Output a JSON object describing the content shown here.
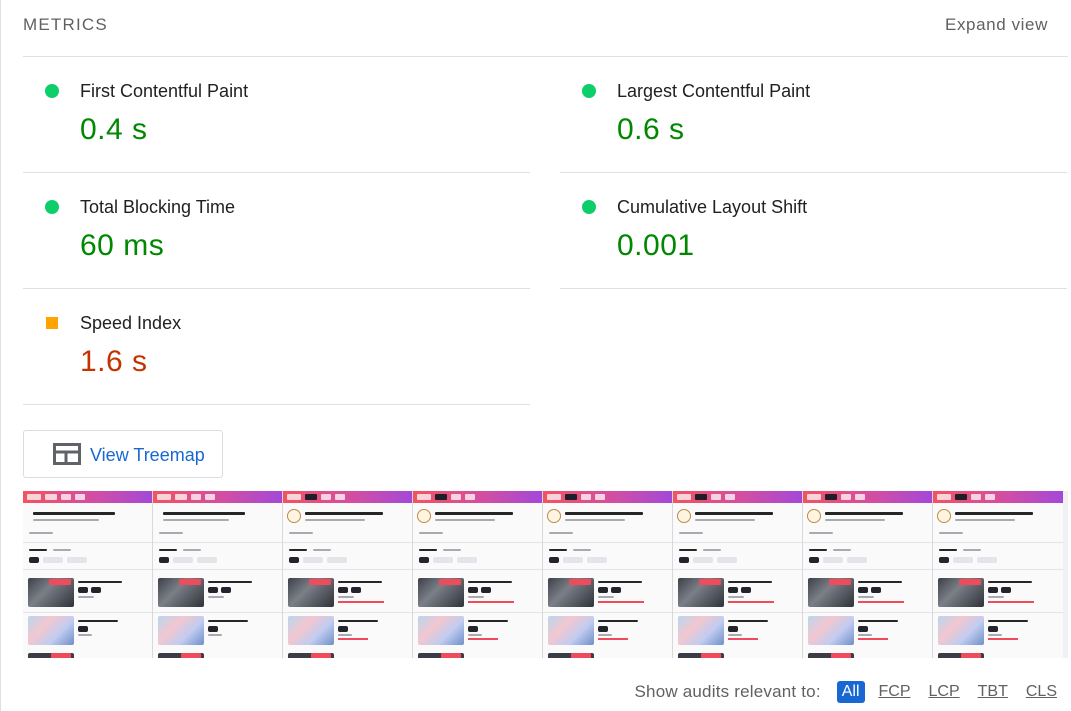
{
  "section": {
    "title": "METRICS",
    "expand_label": "Expand view"
  },
  "metrics": [
    {
      "title": "First Contentful Paint",
      "value": "0.4 s",
      "rating": "pass"
    },
    {
      "title": "Largest Contentful Paint",
      "value": "0.6 s",
      "rating": "pass"
    },
    {
      "title": "Total Blocking Time",
      "value": "60 ms",
      "rating": "pass"
    },
    {
      "title": "Cumulative Layout Shift",
      "value": "0.001",
      "rating": "pass"
    },
    {
      "title": "Speed Index",
      "value": "1.6 s",
      "rating": "average"
    }
  ],
  "treemap": {
    "label": "View Treemap",
    "icon": "treemap-icon"
  },
  "filmstrip": {
    "frame_count": 8
  },
  "audit_filter": {
    "label": "Show audits relevant to:",
    "options": [
      "All",
      "FCP",
      "LCP",
      "TBT",
      "CLS"
    ],
    "selected": "All"
  },
  "colors": {
    "pass": "#0cce6b",
    "pass_text": "#008800",
    "average": "#ffa400",
    "average_text": "#c33300",
    "link": "#1967d2"
  }
}
